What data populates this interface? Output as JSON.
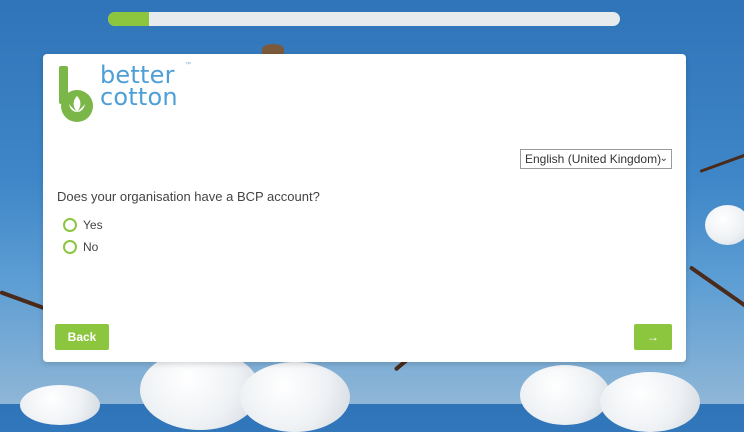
{
  "progress": {
    "fraction": 0.08
  },
  "brand": {
    "line1": "better",
    "line2": "cotton",
    "tm": "™"
  },
  "language": {
    "selected": "English (United Kingdom)"
  },
  "question": {
    "text": "Does your organisation have a BCP account?"
  },
  "options": [
    {
      "label": "Yes"
    },
    {
      "label": "No"
    }
  ],
  "buttons": {
    "back_label": "Back",
    "next_label": "→"
  },
  "colors": {
    "accent": "#8cc63f",
    "logo_blue": "#4e9fd6",
    "logo_green": "#7ab648"
  },
  "icons": [
    "cotton-leaf-icon",
    "chevron-down-icon",
    "arrow-right-icon"
  ]
}
